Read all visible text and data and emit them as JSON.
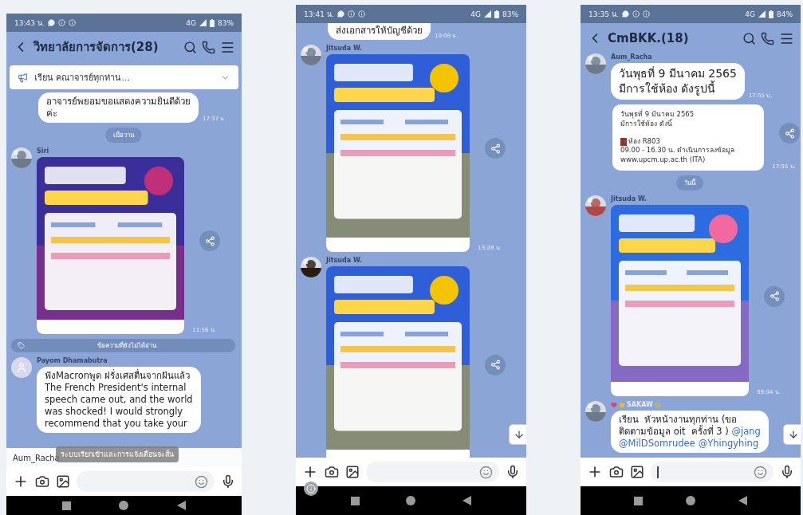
{
  "phones": [
    {
      "status": {
        "time": "13:43 น.",
        "network": "4G",
        "battery": "83%"
      },
      "header": {
        "title": "วิทยาลัยการจัดการ(28)"
      },
      "announcement": {
        "text": "เรียน คณาจารย์ทุกท่าน..."
      },
      "messages": [
        {
          "kind": "text",
          "lines": "อาจารย์พยอมขอแสดงความยินดีด้วย\nค่ะ",
          "time": "17:37 น."
        },
        {
          "kind": "date",
          "text": "เมื่อวาน"
        },
        {
          "kind": "picture",
          "sender": {
            "name": "Siri",
            "photo": true
          },
          "time": "11:56 น.",
          "share": true
        },
        {
          "kind": "unread",
          "text": "ข้อความที่ยังไม่ได้อ่าน"
        },
        {
          "kind": "text",
          "sender": {
            "name": "Payom Dhamabutra",
            "photo": false
          },
          "lines": "ฟังMacronพูด ฝรั่งเศสตื่นจากฝันแล้ว\nThe French President's internal\nspeech came out, and the world\nwas shocked! I would strongly\nrecommend that you take your"
        }
      ],
      "typing": {
        "name": "Aum_Racha",
        "toast": "ระบบเรียกเข้าและการแจ้งเตือนจะสั้น"
      },
      "composer": {
        "focused": false
      },
      "scroll_button": false,
      "info_badge": false
    },
    {
      "status": {
        "time": "13:41 น.",
        "network": "4G",
        "battery": "83%"
      },
      "messages": [
        {
          "kind": "text",
          "lines": "ส่งเอกสารให้บัญชีด้วย",
          "time": "10:08 น.",
          "cut_top": true
        },
        {
          "kind": "picture",
          "sender": {
            "name": "Jitsuda W.",
            "photo": true
          },
          "time": "13:28 น.",
          "share": true
        },
        {
          "kind": "picture",
          "sender": {
            "name": "Jitsuda W.",
            "photo": true
          },
          "share": true
        }
      ],
      "composer": {
        "focused": false
      },
      "scroll_button": true,
      "info_badge": true
    },
    {
      "status": {
        "time": "13:35 น.",
        "network": "4G",
        "battery": "84%"
      },
      "header": {
        "title": "CmBKK.(18)"
      },
      "messages": [
        {
          "kind": "text",
          "sender": {
            "name": "Aum_Racha",
            "photo": true
          },
          "lines": "วันพุธที่ 9 มีนาคม 2565\nมีการใช้ห้อง ดังรูปนี้",
          "time": "17:55 น.",
          "large": true
        },
        {
          "kind": "card",
          "blocks": [
            {
              "kind": "text",
              "text": "วันพุธที่ 9 มีนาคม 2565\nมีการใช้ห้อง ดังนี้"
            },
            {
              "kind": "room",
              "text": "ห้อง R803"
            },
            {
              "kind": "text",
              "text": "09.00 - 16.30 น. ดำเนินการลงข้อมูล\nwww.upcm.up.ac.th (ITA)"
            }
          ],
          "time": "17:55 น.",
          "share": true
        },
        {
          "kind": "date",
          "text": "วันนี้"
        },
        {
          "kind": "picture",
          "sender": {
            "name": "Jitsuda W.",
            "photo": true
          },
          "time": "09:04 น.",
          "share": true
        },
        {
          "kind": "mention",
          "sender": {
            "name": "SAKAW",
            "photo": true,
            "decorated": true
          },
          "lines": [
            [
              {
                "kind": "text",
                "text": "เรียน  หัวหน้างานทุกท่าน (ขอ"
              }
            ],
            [
              {
                "kind": "text",
                "text": "ติดตามข้อมูล oit  ครั้งที่ 3 ) "
              },
              {
                "kind": "mention",
                "text": "@jang"
              }
            ],
            [
              {
                "kind": "mention",
                "text": "@MilDSomrudee"
              },
              {
                "kind": "mention",
                "text": "@Yhingyhing"
              }
            ]
          ]
        }
      ],
      "composer": {
        "focused": true
      },
      "scroll_button": true,
      "info_badge": false
    }
  ]
}
